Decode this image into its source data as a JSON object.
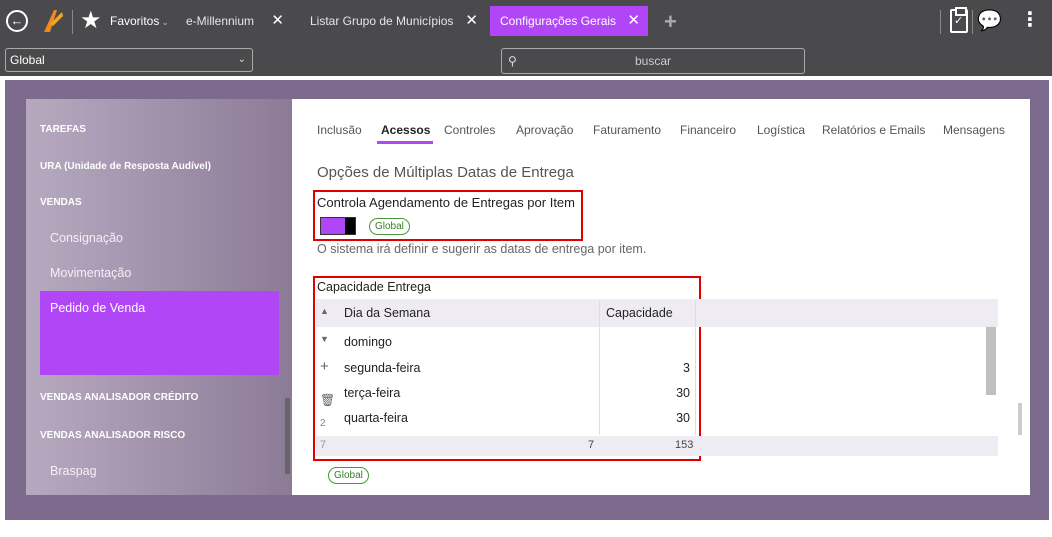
{
  "topbar": {
    "favorites_label": "Favoritos",
    "tabs": [
      {
        "label": "e-Millennium"
      },
      {
        "label": "Listar Grupo de Municípios"
      },
      {
        "label": "Configurações Gerais"
      }
    ]
  },
  "toolbar": {
    "scope_select": "Global",
    "search_placeholder": "buscar"
  },
  "sidebar": {
    "items": [
      {
        "label": "TAREFAS"
      },
      {
        "label": "URA (Unidade de Resposta Audível)"
      },
      {
        "label": "VENDAS"
      },
      {
        "label": "Consignação"
      },
      {
        "label": "Movimentação"
      },
      {
        "label": "Pedido de Venda"
      },
      {
        "label": "VENDAS ANALISADOR CRÉDITO"
      },
      {
        "label": "VENDAS ANALISADOR RISCO"
      },
      {
        "label": "Braspag"
      }
    ]
  },
  "content": {
    "tabs": [
      {
        "label": "Inclusão"
      },
      {
        "label": "Acessos"
      },
      {
        "label": "Controles"
      },
      {
        "label": "Aprovação"
      },
      {
        "label": "Faturamento"
      },
      {
        "label": "Financeiro"
      },
      {
        "label": "Logística"
      },
      {
        "label": "Relatórios e Emails"
      },
      {
        "label": "Mensagens"
      }
    ],
    "section_title": "Opções de Múltiplas Datas de Entrega",
    "control_label": "Controla Agendamento de Entregas por Item",
    "scope_badge": "Global",
    "hint": "O sistema irá definir e sugerir as datas de entrega por item.",
    "capacity": {
      "title": "Capacidade Entrega",
      "columns": [
        "Dia da Semana",
        "Capacidade"
      ],
      "rows": [
        {
          "day": "domingo",
          "capacity": ""
        },
        {
          "day": "segunda-feira",
          "capacity": "3"
        },
        {
          "day": "terça-feira",
          "capacity": "30"
        },
        {
          "day": "quarta-feira",
          "capacity": "30"
        }
      ],
      "row_number": "2",
      "footer": {
        "count_left": "7",
        "count_mid": "7",
        "total": "153"
      },
      "scope_badge": "Global"
    }
  }
}
